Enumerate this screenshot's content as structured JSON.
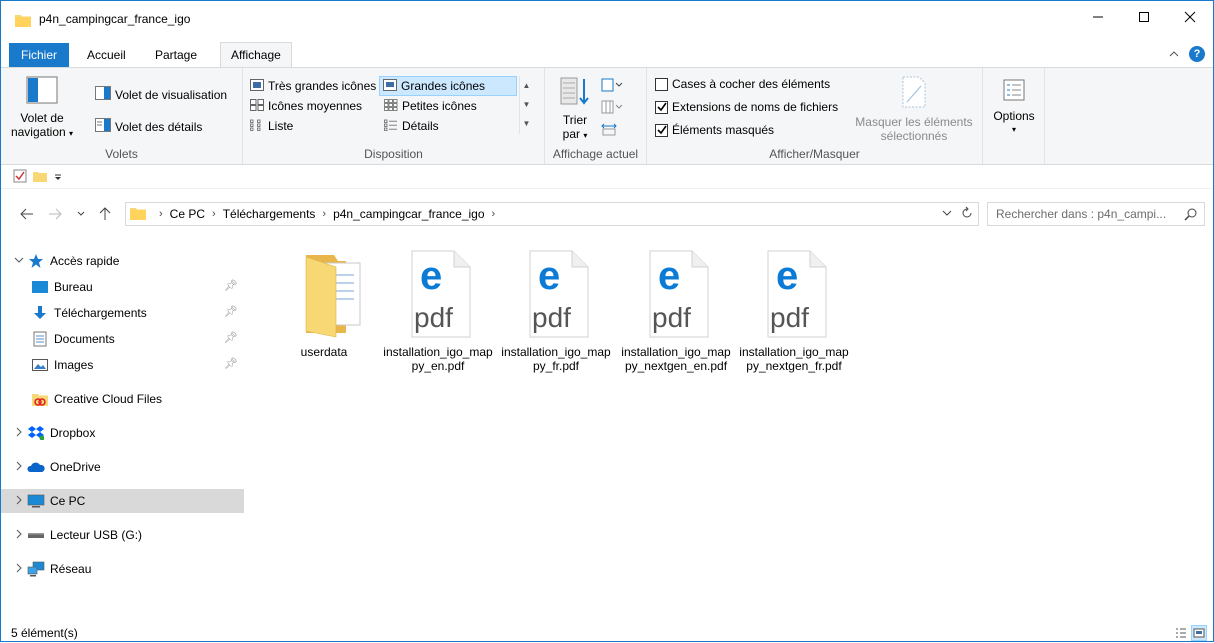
{
  "window": {
    "title": "p4n_campingcar_france_igo",
    "controls": {
      "minimize": "—",
      "maximize": "☐",
      "close": "✕"
    }
  },
  "tabs": {
    "file": "Fichier",
    "home": "Accueil",
    "share": "Partage",
    "view": "Affichage",
    "help": "?"
  },
  "ribbon": {
    "volets": {
      "label": "Volets",
      "nav_pane_line1": "Volet de",
      "nav_pane_line2": "navigation",
      "preview_pane": "Volet de visualisation",
      "details_pane": "Volet des détails"
    },
    "disposition": {
      "label": "Disposition",
      "extra_large": "Très grandes icônes",
      "large": "Grandes icônes",
      "medium": "Icônes moyennes",
      "small": "Petites icônes",
      "list": "Liste",
      "details": "Détails",
      "selected": "large"
    },
    "affichage_actuel": {
      "label": "Affichage actuel",
      "sort_line1": "Trier",
      "sort_line2": "par"
    },
    "afficher_masquer": {
      "label": "Afficher/Masquer",
      "item_checkboxes": {
        "label": "Cases à cocher des éléments",
        "checked": false
      },
      "file_extensions": {
        "label": "Extensions de noms de fichiers",
        "checked": true
      },
      "hidden_items": {
        "label": "Éléments masqués",
        "checked": true
      },
      "hide_selected_line1": "Masquer les éléments",
      "hide_selected_line2": "sélectionnés"
    },
    "options": {
      "label": "Options"
    }
  },
  "address": {
    "breadcrumbs": [
      "Ce PC",
      "Téléchargements",
      "p4n_campingcar_france_igo"
    ],
    "search_placeholder": "Rechercher dans : p4n_campi..."
  },
  "sidebar": {
    "quick_access": "Accès rapide",
    "pinned": [
      {
        "label": "Bureau"
      },
      {
        "label": "Téléchargements"
      },
      {
        "label": "Documents"
      },
      {
        "label": "Images"
      }
    ],
    "creative_cloud": "Creative Cloud Files",
    "dropbox": "Dropbox",
    "onedrive": "OneDrive",
    "this_pc": "Ce PC",
    "usb": "Lecteur USB (G:)",
    "network": "Réseau"
  },
  "files": [
    {
      "name": "userdata",
      "type": "folder"
    },
    {
      "name": "installation_igo_mappy_en.pdf",
      "type": "pdf"
    },
    {
      "name": "installation_igo_mappy_fr.pdf",
      "type": "pdf"
    },
    {
      "name": "installation_igo_mappy_nextgen_en.pdf",
      "type": "pdf"
    },
    {
      "name": "installation_igo_mappy_nextgen_fr.pdf",
      "type": "pdf"
    }
  ],
  "pdf_label": "pdf",
  "status": {
    "count": "5 élément(s)"
  },
  "colors": {
    "accent": "#1979ca",
    "selection": "#cce8ff",
    "folder": "#f8d775",
    "edge_blue": "#0c7bd6"
  }
}
